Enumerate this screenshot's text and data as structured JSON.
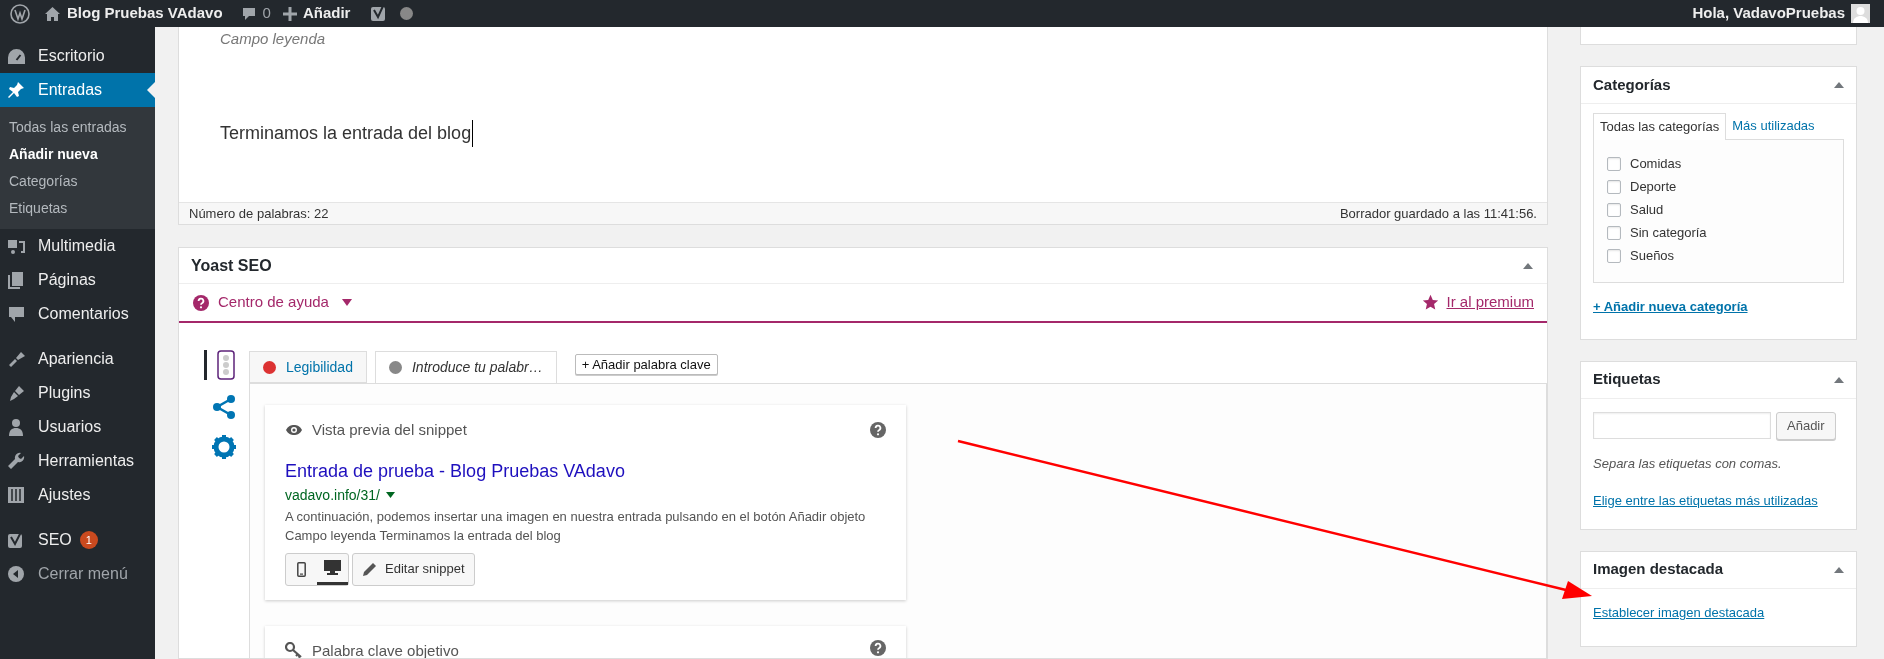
{
  "admin_bar": {
    "site_name": "Blog Pruebas VAdavo",
    "comments_count": "0",
    "new_label": "Añadir",
    "greeting": "Hola, VadavoPruebas"
  },
  "sidebar": {
    "items": [
      {
        "kind": "menu",
        "label": "Escritorio",
        "selected": false
      },
      {
        "kind": "menu",
        "label": "Entradas",
        "selected": true,
        "children": [
          {
            "label": "Todas las entradas",
            "selected": false
          },
          {
            "label": "Añadir nueva",
            "selected": true
          },
          {
            "label": "Categorías",
            "selected": false
          },
          {
            "label": "Etiquetas",
            "selected": false
          }
        ]
      },
      {
        "kind": "menu",
        "label": "Multimedia",
        "selected": false
      },
      {
        "kind": "menu",
        "label": "Páginas",
        "selected": false
      },
      {
        "kind": "menu",
        "label": "Comentarios",
        "selected": false
      },
      {
        "kind": "menu",
        "label": "Apariencia",
        "selected": false
      },
      {
        "kind": "menu",
        "label": "Plugins",
        "selected": false
      },
      {
        "kind": "menu",
        "label": "Usuarios",
        "selected": false
      },
      {
        "kind": "menu",
        "label": "Herramientas",
        "selected": false
      },
      {
        "kind": "menu",
        "label": "Ajustes",
        "selected": false
      },
      {
        "kind": "menu",
        "label": "SEO",
        "selected": false,
        "badge": "1"
      },
      {
        "kind": "collapse",
        "label": "Cerrar menú",
        "selected": false
      }
    ]
  },
  "editor": {
    "caption": "Campo leyenda",
    "paragraph": "Terminamos la entrada del blog",
    "word_count": "Número de palabras: 22",
    "draft_status": "Borrador guardado a las 11:41:56."
  },
  "yoast": {
    "title": "Yoast SEO",
    "help_center": "Centro de ayuda",
    "premium_link": "Ir al premium",
    "side_tabs": [
      {
        "selected": true
      },
      {
        "selected": false
      },
      {
        "selected": false
      }
    ],
    "tabs": [
      {
        "label": "Legibilidad",
        "color": "#dc3232",
        "selected": false
      },
      {
        "label": "Introduce tu palabr…",
        "color": "#888888",
        "selected": true
      }
    ],
    "add_keyword": "+ Añadir palabra clave",
    "snippet": {
      "heading": "Vista previa del snippet",
      "title": "Entrada de prueba - Blog Pruebas VAdavo",
      "url": "vadavo.info/31/",
      "description": "A continuación, podemos insertar una imagen en nuestra entrada pulsando en el botón Añadir objeto Campo leyenda Terminamos la entrada del blog",
      "modes": [
        {
          "kind": "mobile",
          "selected": false
        },
        {
          "kind": "desktop",
          "selected": true
        }
      ],
      "edit_button": "Editar snippet"
    },
    "focus_keyword": {
      "heading": "Palabra clave objetivo"
    }
  },
  "categories": {
    "title": "Categorías",
    "tabs": [
      {
        "label": "Todas las categorías",
        "selected": true
      },
      {
        "label": "Más utilizadas",
        "selected": false
      }
    ],
    "items": [
      {
        "label": "Comidas",
        "checked": false
      },
      {
        "label": "Deporte",
        "checked": false
      },
      {
        "label": "Salud",
        "checked": false
      },
      {
        "label": "Sin categoría",
        "checked": false
      },
      {
        "label": "Sueños",
        "checked": false
      }
    ],
    "add_link": "+ Añadir nueva categoría"
  },
  "tags": {
    "title": "Etiquetas",
    "button": "Añadir",
    "hint": "Separa las etiquetas con comas.",
    "link": "Elige entre las etiquetas más utilizadas"
  },
  "featured_image": {
    "title": "Imagen destacada",
    "link": "Establecer imagen destacada"
  }
}
